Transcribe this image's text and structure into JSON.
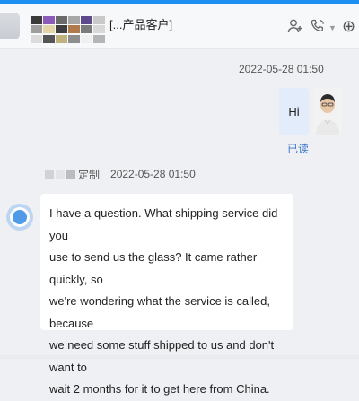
{
  "header": {
    "title": "[...产品客户]",
    "contact_icon": "user-plus-icon",
    "call_icon": "phone-icon",
    "menu_icon": "chevron-down-icon",
    "add_icon": "add-circle-icon"
  },
  "messages": [
    {
      "direction": "outgoing",
      "timestamp": "2022-05-28 01:50",
      "text": "Hi",
      "status": "已读"
    },
    {
      "direction": "incoming",
      "sender_suffix": "定制",
      "timestamp": "2022-05-28 01:50",
      "lines": [
        "I have a question. What shipping service did you",
        "use to send us the glass? It came rather quickly, so",
        "we're wondering what the service is called, because",
        "we need some stuff shipped to us and don't want to",
        "wait 2 months for it to get here from China."
      ]
    }
  ],
  "colors": {
    "accent": "#1f8ef1",
    "outgoing_bubble": "#e3ecfa",
    "incoming_bubble": "#ffffff",
    "read_status": "#3f78c9"
  }
}
